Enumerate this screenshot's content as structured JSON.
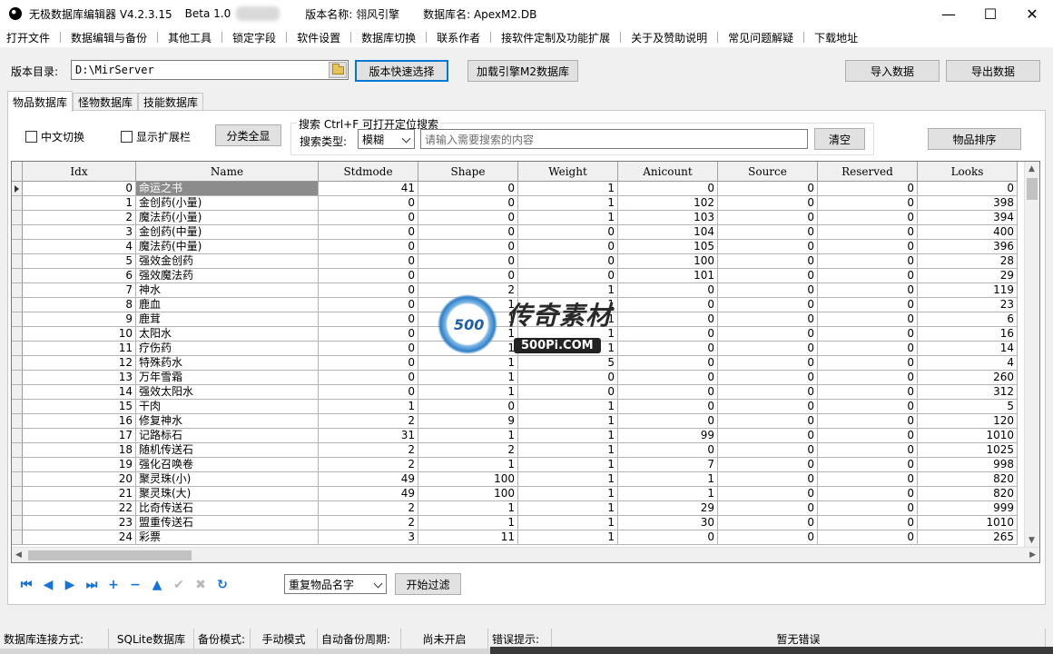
{
  "titlebar": {
    "app_name": "无极数据库编辑器 V4.2.3.15",
    "edition": "Beta 1.0",
    "version_label": "版本名称: 翎风引擎",
    "db_label": "数据库名: ApexM2.DB",
    "minimize": "—",
    "maximize": "☐",
    "close": "✕"
  },
  "menu": [
    "打开文件",
    "数据编辑与备份",
    "其他工具",
    "锁定字段",
    "软件设置",
    "数据库切换",
    "联系作者",
    "接软件定制及功能扩展",
    "关于及赞助说明",
    "常见问题解疑",
    "下载地址"
  ],
  "toolbar": {
    "version_dir_label": "版本目录:",
    "version_dir_value": "D:\\MirServer",
    "quick_select": "版本快速选择",
    "load_engine": "加载引擎M2数据库",
    "import": "导入数据",
    "export": "导出数据"
  },
  "tabs": [
    "物品数据库",
    "怪物数据库",
    "技能数据库"
  ],
  "filters": {
    "cn_switch": "中文切换",
    "show_ext": "显示扩展栏",
    "show_all": "分类全显",
    "search_title": "搜索   Ctrl+F 可打开定位搜索",
    "search_type_label": "搜索类型:",
    "search_type_value": "模糊",
    "search_placeholder": "请输入需要搜索的内容",
    "clear": "清空",
    "sort": "物品排序"
  },
  "grid": {
    "columns": [
      "Idx",
      "Name",
      "Stdmode",
      "Shape",
      "Weight",
      "Anicount",
      "Source",
      "Reserved",
      "Looks"
    ],
    "rows": [
      [
        0,
        "命运之书",
        41,
        0,
        1,
        0,
        0,
        0,
        0
      ],
      [
        1,
        "金创药(小量)",
        0,
        0,
        1,
        102,
        0,
        0,
        398
      ],
      [
        2,
        "魔法药(小量)",
        0,
        0,
        1,
        103,
        0,
        0,
        394
      ],
      [
        3,
        "金创药(中量)",
        0,
        0,
        0,
        104,
        0,
        0,
        400
      ],
      [
        4,
        "魔法药(中量)",
        0,
        0,
        0,
        105,
        0,
        0,
        396
      ],
      [
        5,
        "强效金创药",
        0,
        0,
        0,
        100,
        0,
        0,
        28
      ],
      [
        6,
        "强效魔法药",
        0,
        0,
        0,
        101,
        0,
        0,
        29
      ],
      [
        7,
        "神水",
        0,
        2,
        1,
        0,
        0,
        0,
        119
      ],
      [
        8,
        "鹿血",
        0,
        1,
        1,
        0,
        0,
        0,
        23
      ],
      [
        9,
        "鹿茸",
        0,
        1,
        1,
        0,
        0,
        0,
        6
      ],
      [
        10,
        "太阳水",
        0,
        1,
        1,
        0,
        0,
        0,
        16
      ],
      [
        11,
        "疗伤药",
        0,
        1,
        1,
        0,
        0,
        0,
        14
      ],
      [
        12,
        "特殊药水",
        0,
        1,
        5,
        0,
        0,
        0,
        4
      ],
      [
        13,
        "万年雪霜",
        0,
        1,
        0,
        0,
        0,
        0,
        260
      ],
      [
        14,
        "强效太阳水",
        0,
        1,
        0,
        0,
        0,
        0,
        312
      ],
      [
        15,
        "干肉",
        1,
        0,
        1,
        0,
        0,
        0,
        5
      ],
      [
        16,
        "修复神水",
        2,
        9,
        1,
        0,
        0,
        0,
        120
      ],
      [
        17,
        "记路标石",
        31,
        1,
        1,
        99,
        0,
        0,
        1010
      ],
      [
        18,
        "随机传送石",
        2,
        2,
        1,
        0,
        0,
        0,
        1025
      ],
      [
        19,
        "强化召唤卷",
        2,
        1,
        1,
        7,
        0,
        0,
        998
      ],
      [
        20,
        "聚灵珠(小)",
        49,
        100,
        1,
        1,
        0,
        0,
        820
      ],
      [
        21,
        "聚灵珠(大)",
        49,
        100,
        1,
        1,
        0,
        0,
        820
      ],
      [
        22,
        "比奇传送石",
        2,
        1,
        1,
        29,
        0,
        0,
        999
      ],
      [
        23,
        "盟重传送石",
        2,
        1,
        1,
        30,
        0,
        0,
        1010
      ],
      [
        24,
        "彩票",
        3,
        11,
        1,
        0,
        0,
        0,
        265
      ]
    ]
  },
  "watermark": {
    "badge": "500",
    "cn": "传奇素材",
    "url": "500Pi.COM"
  },
  "navigator": {
    "icons": [
      "first-icon",
      "prior-icon",
      "next-icon",
      "last-icon",
      "insert-icon",
      "delete-icon",
      "edit-icon",
      "post-icon",
      "cancel-icon",
      "refresh-icon"
    ],
    "glyphs": [
      "⏮",
      "◀",
      "▶",
      "⏭",
      "+",
      "−",
      "▲",
      "✔",
      "✖",
      "↻"
    ]
  },
  "bottom": {
    "dup_select": "重复物品名字",
    "start_filter": "开始过滤"
  },
  "status": {
    "conn_label": "数据库连接方式:",
    "conn_value": "SQLite数据库",
    "backup_label": "备份模式:",
    "backup_value": "手动模式",
    "auto_label": "自动备份周期:",
    "auto_value": "尚未开启",
    "err_label": "错误提示:",
    "err_value": "暂无错误"
  }
}
